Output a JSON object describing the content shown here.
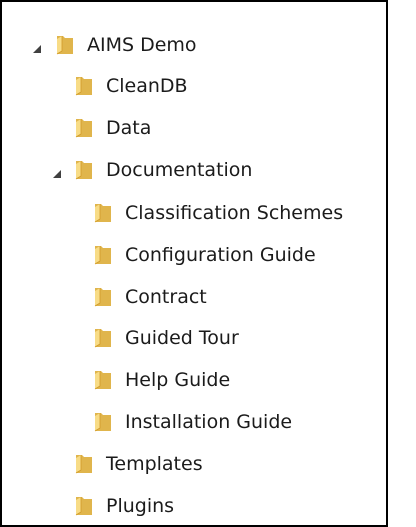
{
  "tree": {
    "root": {
      "label": "AIMS Demo",
      "expanded": true,
      "icon": "folder-icon"
    },
    "items": [
      {
        "label": "CleanDB",
        "icon": "folder-icon"
      },
      {
        "label": "Data",
        "icon": "folder-icon"
      },
      {
        "label": "Documentation",
        "icon": "folder-icon",
        "expanded": true
      },
      {
        "label": "Classification Schemes",
        "icon": "folder-icon"
      },
      {
        "label": "Configuration Guide",
        "icon": "folder-icon"
      },
      {
        "label": "Contract",
        "icon": "folder-icon"
      },
      {
        "label": "Guided Tour",
        "icon": "folder-icon"
      },
      {
        "label": "Help Guide",
        "icon": "folder-icon"
      },
      {
        "label": "Installation Guide",
        "icon": "folder-icon"
      },
      {
        "label": "Templates",
        "icon": "folder-icon"
      },
      {
        "label": "Plugins",
        "icon": "folder-icon"
      }
    ]
  },
  "colors": {
    "frame_border": "#000000",
    "text": "#1b1b1b",
    "folder_light": "#f8dc86",
    "folder_dark": "#e0b54c",
    "expander": "#404040"
  }
}
